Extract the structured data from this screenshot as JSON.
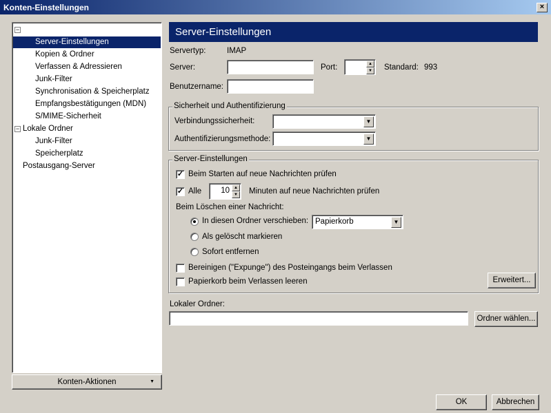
{
  "window": {
    "title": "Konten-Einstellungen",
    "close": "×"
  },
  "tree": {
    "items": [
      {
        "label": "Server-Einstellungen",
        "selected": true
      },
      {
        "label": "Kopien & Ordner"
      },
      {
        "label": "Verfassen & Adressieren"
      },
      {
        "label": "Junk-Filter"
      },
      {
        "label": "Synchronisation & Speicherplatz"
      },
      {
        "label": "Empfangsbestätigungen (MDN)"
      },
      {
        "label": "S/MIME-Sicherheit"
      }
    ],
    "local": {
      "label": "Lokale Ordner",
      "children": [
        "Junk-Filter",
        "Speicherplatz"
      ]
    },
    "outgoing": "Postausgang-Server",
    "expander": "−"
  },
  "account_actions": "Konten-Aktionen",
  "header": "Server-Einstellungen",
  "servertype": {
    "label": "Servertyp:",
    "value": "IMAP"
  },
  "server": {
    "label": "Server:",
    "value": ""
  },
  "port": {
    "label": "Port:",
    "value": "",
    "standard_label": "Standard:",
    "standard_value": "993"
  },
  "username": {
    "label": "Benutzername:",
    "value": ""
  },
  "security": {
    "legend": "Sicherheit und Authentifizierung",
    "connection_label": "Verbindungssicherheit:",
    "connection_value": "",
    "auth_label": "Authentifizierungsmethode:",
    "auth_value": ""
  },
  "server_settings": {
    "legend": "Server-Einstellungen",
    "check_on_start": {
      "label": "Beim Starten auf neue Nachrichten prüfen",
      "checked": true
    },
    "check_every": {
      "label": "Alle",
      "checked": true,
      "value": "10",
      "suffix": "Minuten auf neue Nachrichten prüfen"
    },
    "on_delete": "Beim Löschen einer Nachricht:",
    "radios": [
      {
        "label": "In diesen Ordner verschieben:",
        "checked": true
      },
      {
        "label": "Als gelöscht markieren"
      },
      {
        "label": "Sofort entfernen"
      }
    ],
    "trash_folder": "Papierkorb",
    "expunge": {
      "label": "Bereinigen (\"Expunge\") des Posteingangs beim Verlassen",
      "checked": false
    },
    "empty_trash": {
      "label": "Papierkorb beim Verlassen leeren",
      "checked": false
    },
    "advanced": "Erweitert..."
  },
  "local_folder": {
    "label": "Lokaler Ordner:",
    "value": "",
    "choose": "Ordner wählen..."
  },
  "ok": "OK",
  "cancel": "Abbrechen"
}
